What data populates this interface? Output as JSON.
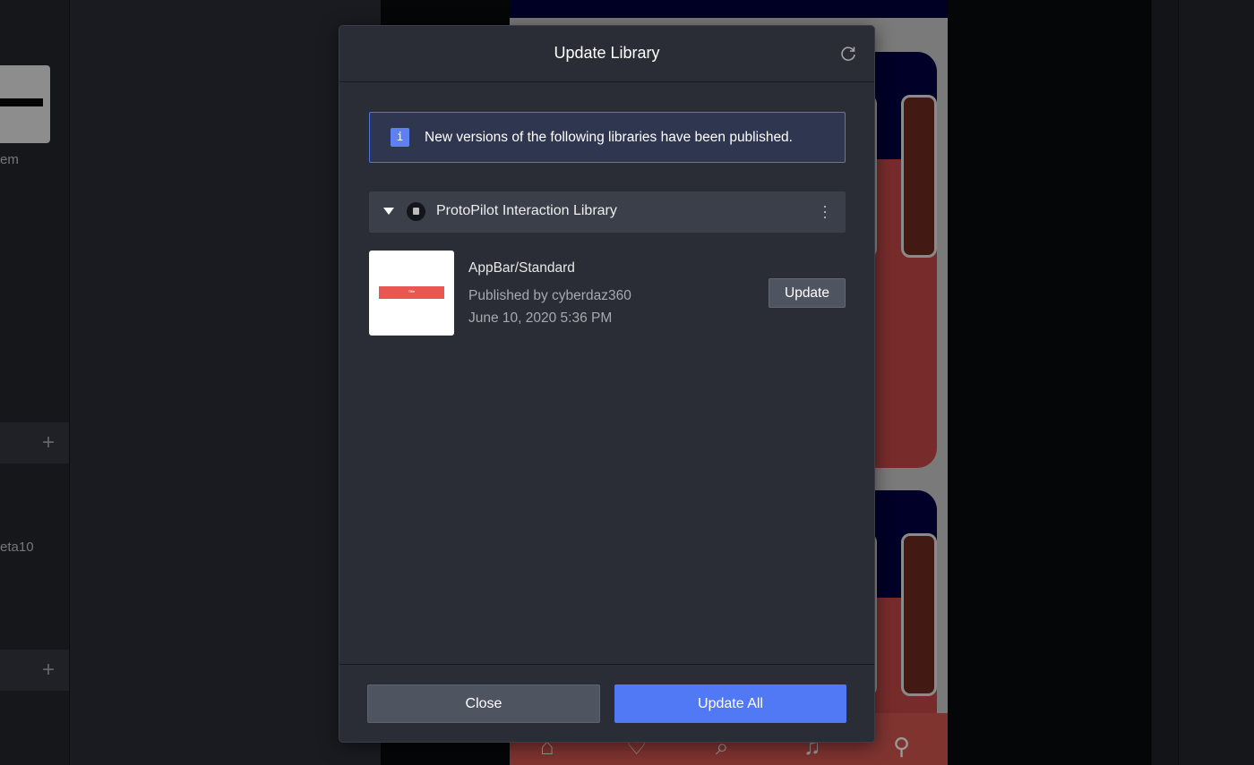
{
  "background": {
    "left_panel": {
      "item_label_1": "em",
      "item_label_2": "eta10",
      "add_icon": "plus-icon"
    },
    "canvas": {
      "tab_icons": [
        "home-icon",
        "heart-icon",
        "search-icon",
        "bell-icon",
        "user-icon"
      ]
    }
  },
  "dialog": {
    "title": "Update Library",
    "refresh_icon": "refresh-icon",
    "info": {
      "icon": "i",
      "message": "New versions of the following libraries have been published."
    },
    "library": {
      "name": "ProtoPilot Interaction Library",
      "expanded": true,
      "items": [
        {
          "name": "AppBar/Standard",
          "thumbnail_title": "Title",
          "published_by": "Published by cyberdaz360",
          "date": "June 10, 2020 5:36 PM",
          "update_label": "Update"
        }
      ]
    },
    "footer": {
      "close_label": "Close",
      "update_all_label": "Update All"
    }
  },
  "colors": {
    "accent": "#5279f5",
    "info_border": "#5173e8",
    "dialog_bg": "#2a2d35"
  }
}
